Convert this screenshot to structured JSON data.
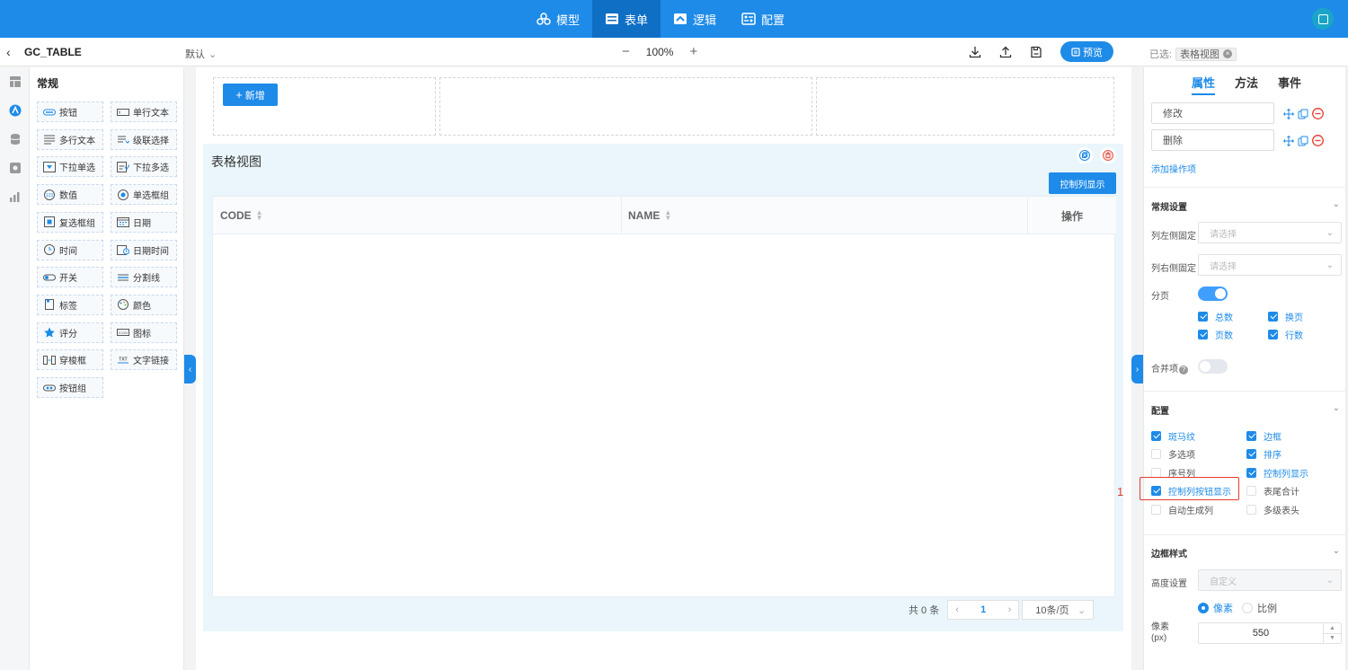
{
  "nav": {
    "tabs": [
      {
        "label": "模型",
        "icon": "model-icon"
      },
      {
        "label": "表单",
        "icon": "form-icon"
      },
      {
        "label": "逻辑",
        "icon": "logic-icon"
      },
      {
        "label": "配置",
        "icon": "config-icon"
      }
    ],
    "active_tab": "表单",
    "accent": "#1e8be8"
  },
  "toolbar": {
    "title": "GC_TABLE",
    "mode": "默认",
    "zoom": "100%",
    "preview_label": "预览",
    "selected_label": "已选:",
    "selected_tag": "表格视图"
  },
  "components": {
    "heading": "常规",
    "items": [
      {
        "label": "按钮",
        "icon": "button-icon"
      },
      {
        "label": "单行文本",
        "icon": "single-line-text-icon"
      },
      {
        "label": "多行文本",
        "icon": "multi-line-text-icon"
      },
      {
        "label": "级联选择",
        "icon": "cascader-icon"
      },
      {
        "label": "下拉单选",
        "icon": "dropdown-single-icon"
      },
      {
        "label": "下拉多选",
        "icon": "dropdown-multi-icon"
      },
      {
        "label": "数值",
        "icon": "number-icon"
      },
      {
        "label": "单选框组",
        "icon": "radio-group-icon"
      },
      {
        "label": "复选框组",
        "icon": "checkbox-group-icon"
      },
      {
        "label": "日期",
        "icon": "date-icon"
      },
      {
        "label": "时间",
        "icon": "time-icon"
      },
      {
        "label": "日期时间",
        "icon": "datetime-icon"
      },
      {
        "label": "开关",
        "icon": "switch-icon"
      },
      {
        "label": "分割线",
        "icon": "divider-icon"
      },
      {
        "label": "标签",
        "icon": "label-icon"
      },
      {
        "label": "颜色",
        "icon": "palette-icon"
      },
      {
        "label": "评分",
        "icon": "star-icon"
      },
      {
        "label": "图标",
        "icon": "icon-icon"
      },
      {
        "label": "穿梭框",
        "icon": "transfer-icon"
      },
      {
        "label": "文字链接",
        "icon": "text-link-icon"
      },
      {
        "label": "按钮组",
        "icon": "button-group-icon"
      }
    ]
  },
  "canvas": {
    "add_label": "新增",
    "table_title": "表格视图",
    "ctrl_btn_label": "控制列显示",
    "columns": [
      {
        "label": "CODE",
        "sortable": true
      },
      {
        "label": "NAME",
        "sortable": true
      },
      {
        "label": "操作",
        "sortable": false
      }
    ],
    "pager": {
      "total_text": "共 0 条",
      "current_page": "1",
      "page_size": "10条/页"
    }
  },
  "props": {
    "tabs": [
      "属性",
      "方法",
      "事件"
    ],
    "active_tab": "属性",
    "operations": [
      "修改",
      "删除"
    ],
    "add_op_label": "添加操作项",
    "general": {
      "title": "常规设置",
      "left_fix_label": "列左侧固定",
      "right_fix_label": "列右侧固定",
      "select_placeholder": "请选择",
      "paging_label": "分页",
      "paging_on": true,
      "paging_options": [
        {
          "label": "总数",
          "checked": true
        },
        {
          "label": "换页",
          "checked": true
        },
        {
          "label": "页数",
          "checked": true
        },
        {
          "label": "行数",
          "checked": true
        }
      ],
      "merge_label": "合并项",
      "merge_on": false
    },
    "config": {
      "title": "配置",
      "options": [
        {
          "label": "斑马纹",
          "checked": true
        },
        {
          "label": "边框",
          "checked": true
        },
        {
          "label": "多选项",
          "checked": false
        },
        {
          "label": "排序",
          "checked": true
        },
        {
          "label": "序号列",
          "checked": false
        },
        {
          "label": "控制列显示",
          "checked": true
        },
        {
          "label": "控制列按钮显示",
          "checked": true
        },
        {
          "label": "表尾合计",
          "checked": false
        },
        {
          "label": "自动生成列",
          "checked": false
        },
        {
          "label": "多级表头",
          "checked": false
        }
      ]
    },
    "border_style": {
      "title": "边框样式",
      "height_label": "高度设置",
      "height_value": "自定义",
      "unit_options": [
        {
          "label": "像素",
          "selected": true
        },
        {
          "label": "比例",
          "selected": false
        }
      ],
      "px_label": "像素",
      "px_unit": "(px)",
      "px_value": "550"
    }
  },
  "annotation": {
    "marker": "1",
    "color": "#e63b2e"
  }
}
